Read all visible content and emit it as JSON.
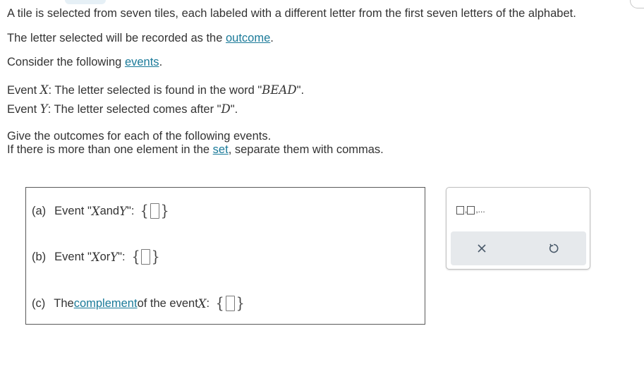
{
  "problem": {
    "line1": "A tile is selected from seven tiles, each labeled with a different letter from the first seven letters of the alphabet.",
    "line2_prefix": "The letter selected will be recorded as the ",
    "line2_link": "outcome",
    "line2_suffix": ".",
    "line3_prefix": "Consider the following ",
    "line3_link": "events",
    "line3_suffix": ".",
    "eventX": {
      "label": "Event ",
      "var": "X",
      "text": ": The letter selected is found in the word \"",
      "word": "BEAD",
      "end": "\"."
    },
    "eventY": {
      "label": "Event ",
      "var": "Y",
      "text": ": The letter selected comes after \"",
      "letter": "D",
      "end": "\"."
    },
    "instr1": "Give the outcomes for each of the following events.",
    "instr2_prefix": "If there is more than one element in the ",
    "instr2_link": "set",
    "instr2_suffix": ", separate them with commas."
  },
  "questions": {
    "a": {
      "prefix": "(a)",
      "pre": "Event \"",
      "v1": "X",
      "mid": " and ",
      "v2": "Y",
      "post": "\":"
    },
    "b": {
      "prefix": "(b)",
      "pre": "Event \"",
      "v1": "X",
      "mid": " or ",
      "v2": "Y",
      "post": "\":"
    },
    "c": {
      "prefix": "(c)",
      "pre": "The ",
      "link": "complement",
      "mid": " of the event ",
      "v1": "X",
      "post": ":"
    }
  },
  "braces": {
    "open": "{",
    "close": "}"
  },
  "toolbar": {
    "list_ellipsis": ",...",
    "list_comma": ",",
    "clear_icon": "times-icon",
    "undo_icon": "undo-icon",
    "icon_color": "#4a5a6a"
  }
}
